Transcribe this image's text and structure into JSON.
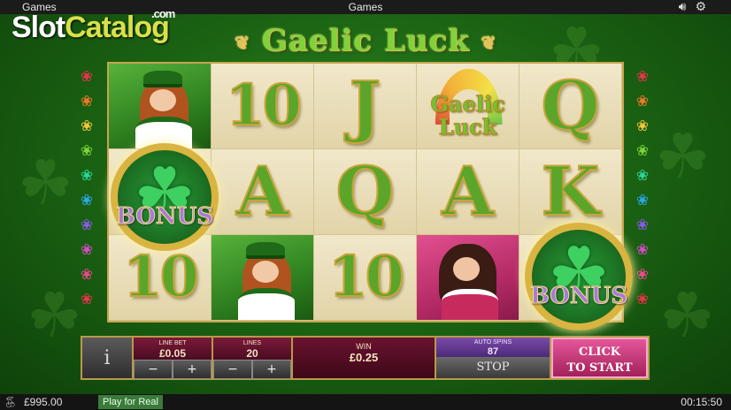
{
  "topbar": {
    "left_label": "Games",
    "center_label": "Games",
    "sound_icon": "speaker-icon",
    "settings_icon": "gear-icon"
  },
  "watermark": {
    "part1": "Slot",
    "part2": "Catalog",
    "suffix": ".com"
  },
  "game": {
    "title": "Gaelic Luck"
  },
  "reels": {
    "rows": [
      [
        "lady",
        "10",
        "J",
        "logo",
        "Q"
      ],
      [
        "bonus",
        "A",
        "Q",
        "A",
        "K"
      ],
      [
        "10",
        "lady",
        "10",
        "brunette",
        "bonus"
      ]
    ],
    "logo_text": "Gaelic Luck",
    "bonus_text": "BONUS"
  },
  "side_gems": {
    "colors": [
      "#e8334a",
      "#f07a2a",
      "#f2c43a",
      "#7ad33a",
      "#2ad39a",
      "#2aa8e8",
      "#8a5ae8",
      "#d84ac8",
      "#e8488a",
      "#e8334a"
    ]
  },
  "controls": {
    "info_label": "i",
    "line_bet": {
      "label": "LINE BET",
      "value": "£0.05",
      "minus": "−",
      "plus": "+"
    },
    "lines": {
      "label": "LINES",
      "value": "20",
      "minus": "−",
      "plus": "+"
    },
    "win": {
      "label": "WIN",
      "value": "£0.25"
    },
    "auto_spins": {
      "label": "AUTO SPINS",
      "value": "87",
      "stop_label": "STOP"
    },
    "start_label_line1": "CLICK",
    "start_label_line2": "TO START"
  },
  "bottombar": {
    "balance": "£995.00",
    "play_for_real": "Play for Real",
    "clock": "00:15:50"
  }
}
